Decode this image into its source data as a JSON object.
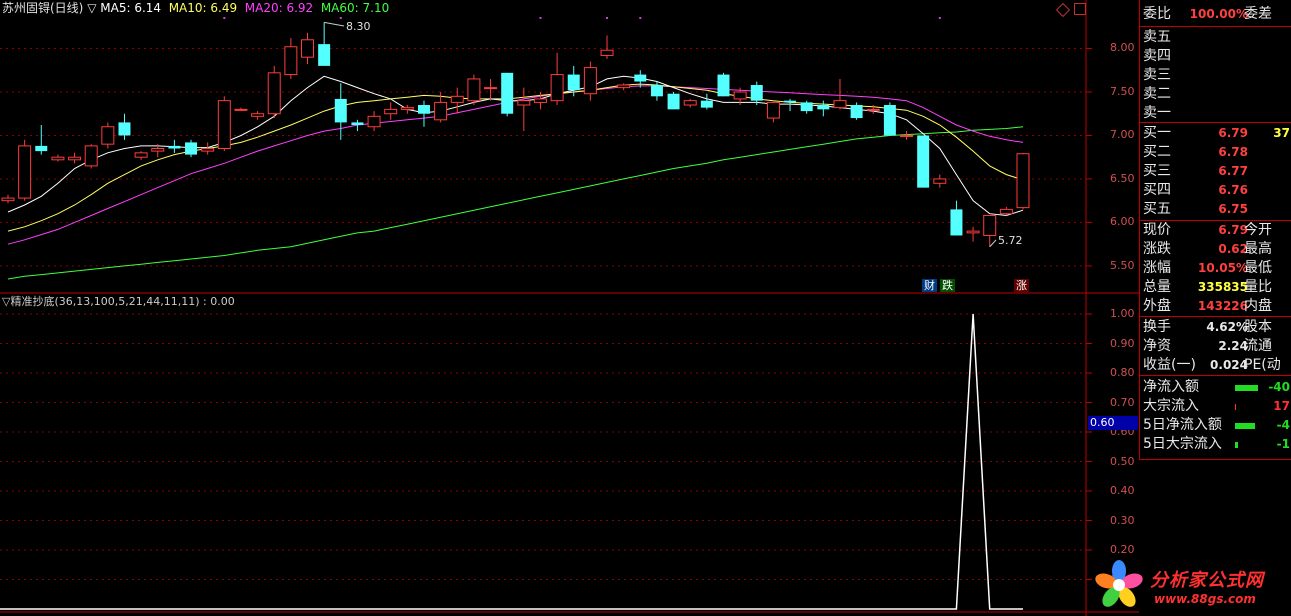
{
  "header": {
    "stock": "苏州固锝(日线)",
    "ma5_label": "MA5: 6.14",
    "ma10_label": "MA10: 6.49",
    "ma20_label": "MA20: 6.92",
    "ma60_label": "MA60: 7.10",
    "arrow": "▽"
  },
  "colors": {
    "up": "#ff3c3c",
    "down": "#54ffff",
    "ma5": "#ffffff",
    "ma10": "#ffff60",
    "ma20": "#ff40ff",
    "ma60": "#40ff40",
    "grid": "#8b0000"
  },
  "price_axis": {
    "labels": [
      "8.00",
      "7.50",
      "7.00",
      "6.50",
      "6.00",
      "5.50"
    ],
    "values": [
      8.0,
      7.5,
      7.0,
      6.5,
      6.0,
      5.5
    ]
  },
  "annotations": {
    "high": "8.30",
    "low": "5.72"
  },
  "signals": {
    "cai": "财",
    "die": "跌",
    "zhang": "涨"
  },
  "indicator": {
    "title": "▽精准抄底(36,13,100,5,21,44,11,11) : 0.00",
    "axis_labels": [
      "1.00",
      "0.90",
      "0.80",
      "0.70",
      "0.60",
      "0.50",
      "0.40",
      "0.30",
      "0.20",
      "0.10"
    ],
    "axis_values": [
      1.0,
      0.9,
      0.8,
      0.7,
      0.6,
      0.5,
      0.4,
      0.3,
      0.2,
      0.1
    ],
    "current": "0.60"
  },
  "chart_data": {
    "type": "candlestick",
    "candles": [
      [
        6.25,
        6.32,
        6.22,
        6.28
      ],
      [
        6.28,
        6.95,
        6.25,
        6.88
      ],
      [
        6.88,
        7.12,
        6.78,
        6.82
      ],
      [
        6.72,
        6.78,
        6.7,
        6.75
      ],
      [
        6.72,
        6.8,
        6.68,
        6.75
      ],
      [
        6.65,
        6.9,
        6.62,
        6.88
      ],
      [
        6.9,
        7.15,
        6.85,
        7.1
      ],
      [
        7.15,
        7.25,
        6.95,
        7.0
      ],
      [
        6.75,
        6.82,
        6.72,
        6.8
      ],
      [
        6.82,
        6.9,
        6.75,
        6.85
      ],
      [
        6.88,
        6.95,
        6.8,
        6.85
      ],
      [
        6.92,
        6.95,
        6.75,
        6.78
      ],
      [
        6.82,
        6.92,
        6.78,
        6.85
      ],
      [
        6.85,
        7.45,
        6.82,
        7.4
      ],
      [
        7.3,
        7.32,
        7.28,
        7.3
      ],
      [
        7.22,
        7.28,
        7.18,
        7.25
      ],
      [
        7.25,
        7.8,
        7.2,
        7.72
      ],
      [
        7.7,
        8.12,
        7.65,
        8.02
      ],
      [
        7.9,
        8.18,
        7.82,
        8.1
      ],
      [
        8.05,
        8.3,
        7.88,
        7.8
      ],
      [
        7.42,
        7.6,
        6.95,
        7.15
      ],
      [
        7.15,
        7.18,
        7.05,
        7.12
      ],
      [
        7.1,
        7.28,
        7.05,
        7.22
      ],
      [
        7.25,
        7.38,
        7.18,
        7.3
      ],
      [
        7.3,
        7.35,
        7.25,
        7.32
      ],
      [
        7.35,
        7.4,
        7.1,
        7.25
      ],
      [
        7.18,
        7.5,
        7.15,
        7.38
      ],
      [
        7.38,
        7.55,
        7.25,
        7.45
      ],
      [
        7.4,
        7.7,
        7.35,
        7.65
      ],
      [
        7.55,
        7.65,
        7.4,
        7.55
      ],
      [
        7.72,
        7.72,
        7.22,
        7.25
      ],
      [
        7.35,
        7.55,
        7.05,
        7.4
      ],
      [
        7.38,
        7.5,
        7.3,
        7.42
      ],
      [
        7.4,
        7.95,
        7.35,
        7.7
      ],
      [
        7.7,
        7.8,
        7.45,
        7.52
      ],
      [
        7.48,
        7.85,
        7.4,
        7.78
      ],
      [
        7.92,
        8.15,
        7.88,
        7.98
      ],
      [
        7.55,
        7.6,
        7.52,
        7.58
      ],
      [
        7.7,
        7.75,
        7.55,
        7.62
      ],
      [
        7.58,
        7.62,
        7.4,
        7.45
      ],
      [
        7.48,
        7.5,
        7.3,
        7.3
      ],
      [
        7.35,
        7.42,
        7.32,
        7.4
      ],
      [
        7.4,
        7.48,
        7.3,
        7.32
      ],
      [
        7.7,
        7.72,
        7.45,
        7.45
      ],
      [
        7.42,
        7.55,
        7.35,
        7.5
      ],
      [
        7.58,
        7.62,
        7.35,
        7.4
      ],
      [
        7.2,
        7.4,
        7.15,
        7.38
      ],
      [
        7.4,
        7.42,
        7.28,
        7.38
      ],
      [
        7.38,
        7.4,
        7.25,
        7.28
      ],
      [
        7.35,
        7.4,
        7.22,
        7.3
      ],
      [
        7.32,
        7.65,
        7.3,
        7.4
      ],
      [
        7.35,
        7.38,
        7.18,
        7.2
      ],
      [
        7.3,
        7.35,
        7.25,
        7.3
      ],
      [
        7.35,
        7.38,
        7.0,
        7.0
      ],
      [
        7.0,
        7.05,
        6.95,
        7.0
      ],
      [
        7.0,
        7.0,
        6.4,
        6.4
      ],
      [
        6.45,
        6.55,
        6.4,
        6.5
      ],
      [
        6.15,
        6.25,
        5.85,
        5.85
      ],
      [
        5.88,
        5.95,
        5.78,
        5.9
      ],
      [
        5.85,
        6.0,
        5.72,
        6.08
      ],
      [
        6.1,
        6.18,
        6.08,
        6.15
      ],
      [
        6.17,
        6.8,
        6.15,
        6.79
      ]
    ],
    "ma5": [
      6.12,
      6.2,
      6.3,
      6.45,
      6.62,
      6.72,
      6.8,
      6.85,
      6.88,
      6.88,
      6.87,
      6.86,
      6.86,
      6.92,
      7.0,
      7.1,
      7.22,
      7.4,
      7.55,
      7.68,
      7.62,
      7.55,
      7.48,
      7.42,
      7.3,
      7.26,
      7.28,
      7.33,
      7.38,
      7.42,
      7.4,
      7.4,
      7.42,
      7.48,
      7.52,
      7.56,
      7.65,
      7.68,
      7.66,
      7.62,
      7.55,
      7.48,
      7.42,
      7.38,
      7.38,
      7.38,
      7.36,
      7.36,
      7.35,
      7.34,
      7.32,
      7.3,
      7.28,
      7.25,
      7.18,
      7.02,
      6.85,
      6.55,
      6.25,
      6.1,
      6.08,
      6.14
    ],
    "ma10": [
      5.9,
      5.95,
      6.02,
      6.1,
      6.2,
      6.32,
      6.45,
      6.55,
      6.65,
      6.72,
      6.78,
      6.82,
      6.85,
      6.88,
      6.92,
      6.98,
      7.05,
      7.12,
      7.2,
      7.28,
      7.34,
      7.38,
      7.4,
      7.42,
      7.44,
      7.46,
      7.45,
      7.43,
      7.42,
      7.42,
      7.42,
      7.44,
      7.46,
      7.48,
      7.5,
      7.52,
      7.55,
      7.58,
      7.59,
      7.58,
      7.56,
      7.54,
      7.52,
      7.48,
      7.45,
      7.42,
      7.4,
      7.38,
      7.37,
      7.36,
      7.35,
      7.34,
      7.33,
      7.31,
      7.29,
      7.22,
      7.12,
      6.98,
      6.82,
      6.65,
      6.55,
      6.49
    ],
    "ma20": [
      5.75,
      5.8,
      5.86,
      5.92,
      6.0,
      6.08,
      6.16,
      6.24,
      6.32,
      6.4,
      6.48,
      6.56,
      6.62,
      6.68,
      6.75,
      6.82,
      6.88,
      6.94,
      7.0,
      7.05,
      7.08,
      7.12,
      7.14,
      7.16,
      7.18,
      7.2,
      7.22,
      7.26,
      7.3,
      7.34,
      7.38,
      7.42,
      7.45,
      7.48,
      7.5,
      7.52,
      7.54,
      7.56,
      7.57,
      7.57,
      7.56,
      7.55,
      7.54,
      7.53,
      7.52,
      7.51,
      7.5,
      7.49,
      7.48,
      7.47,
      7.46,
      7.45,
      7.44,
      7.42,
      7.4,
      7.32,
      7.22,
      7.12,
      7.05,
      6.99,
      6.95,
      6.92
    ],
    "ma60": [
      5.35,
      5.38,
      5.4,
      5.42,
      5.44,
      5.46,
      5.48,
      5.5,
      5.52,
      5.54,
      5.56,
      5.58,
      5.6,
      5.62,
      5.65,
      5.68,
      5.7,
      5.72,
      5.76,
      5.8,
      5.84,
      5.88,
      5.9,
      5.94,
      5.98,
      6.02,
      6.06,
      6.1,
      6.14,
      6.18,
      6.22,
      6.26,
      6.3,
      6.34,
      6.38,
      6.42,
      6.46,
      6.5,
      6.54,
      6.58,
      6.62,
      6.65,
      6.68,
      6.72,
      6.75,
      6.78,
      6.81,
      6.84,
      6.87,
      6.9,
      6.93,
      6.96,
      6.98,
      7.0,
      7.01,
      7.02,
      7.03,
      7.04,
      7.06,
      7.07,
      7.08,
      7.1
    ],
    "indicator": [
      0,
      0,
      0,
      0,
      0,
      0,
      0,
      0,
      0,
      0,
      0,
      0,
      0,
      0,
      0,
      0,
      0,
      0,
      0,
      0,
      0,
      0,
      0,
      0,
      0,
      0,
      0,
      0,
      0,
      0,
      0,
      0,
      0,
      0,
      0,
      0,
      0,
      0,
      0,
      0,
      0,
      0,
      0,
      0,
      0,
      0,
      0,
      0,
      0,
      0,
      0,
      0,
      0,
      0,
      0,
      0,
      0,
      0,
      1.0,
      0,
      0,
      0
    ]
  },
  "panel": {
    "weibi_label": "委比",
    "weibi_value": "100.00%",
    "weicha_label": "委差",
    "sells": [
      "卖五",
      "卖四",
      "卖三",
      "卖二",
      "卖一"
    ],
    "buys": [
      {
        "label": "买一",
        "price": "6.79",
        "vol": "37"
      },
      {
        "label": "买二",
        "price": "6.78",
        "vol": ""
      },
      {
        "label": "买三",
        "price": "6.77",
        "vol": ""
      },
      {
        "label": "买四",
        "price": "6.76",
        "vol": ""
      },
      {
        "label": "买五",
        "price": "6.75",
        "vol": ""
      }
    ],
    "quotes": [
      {
        "label": "现价",
        "value": "6.79",
        "label2": "今开",
        "color": "#ff4040"
      },
      {
        "label": "涨跌",
        "value": "0.62",
        "label2": "最高",
        "color": "#ff4040"
      },
      {
        "label": "涨幅",
        "value": "10.05%",
        "label2": "最低",
        "color": "#ff4040"
      },
      {
        "label": "总量",
        "value": "335835",
        "label2": "量比",
        "color": "#ffff40"
      },
      {
        "label": "外盘",
        "value": "143226",
        "label2": "内盘",
        "color": "#ff4040"
      }
    ],
    "quotes2": [
      {
        "label": "换手",
        "value": "4.62%",
        "label2": "股本",
        "color": "#e8e8e8"
      },
      {
        "label": "净资",
        "value": "2.24",
        "label2": "流通",
        "color": "#e8e8e8"
      },
      {
        "label": "收益(一)",
        "value": "0.024",
        "label2": "PE(动",
        "color": "#e8e8e8"
      }
    ],
    "flows": [
      {
        "label": "净流入额",
        "value": "-40",
        "bar": 38,
        "color": "#22dd22"
      },
      {
        "label": "大宗流入",
        "value": "17",
        "bar": 2,
        "color": "#ff3030"
      },
      {
        "label": "5日净流入额",
        "value": "-4",
        "bar": 34,
        "color": "#22dd22"
      },
      {
        "label": "5日大宗流入",
        "value": "-1",
        "bar": 5,
        "color": "#22dd22"
      }
    ]
  },
  "logo": {
    "text": "分析家公式网",
    "url": "www.88gs.com"
  }
}
